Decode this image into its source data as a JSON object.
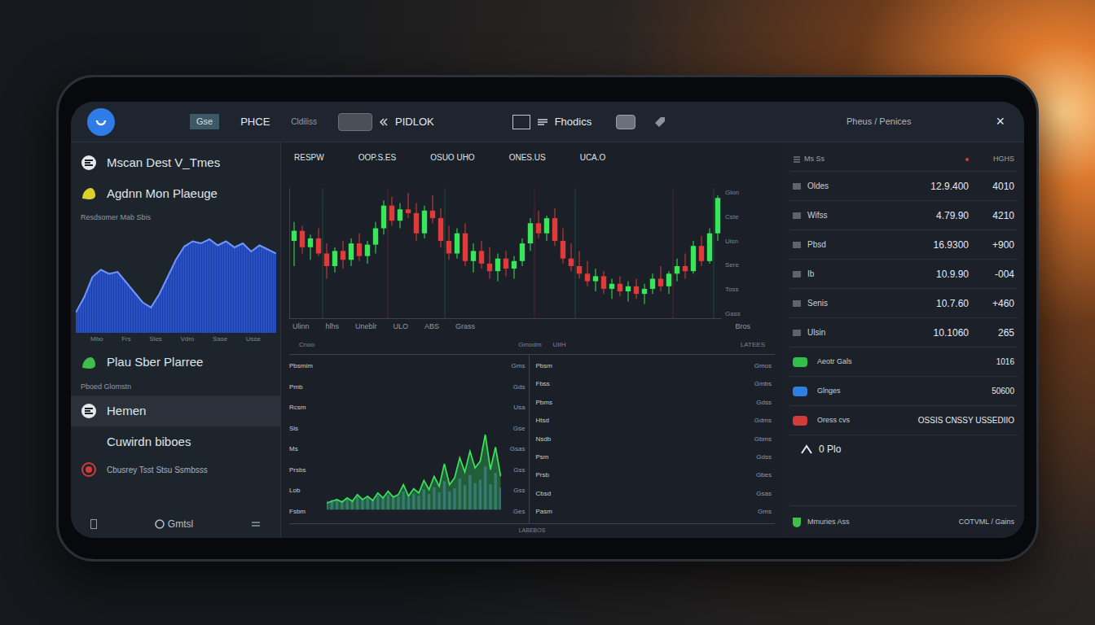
{
  "topbar": {
    "nav": [
      {
        "label": "Gse",
        "kind": "badge"
      },
      {
        "label": "PHCE",
        "kind": "text"
      },
      {
        "label": "Cldiliss",
        "kind": "muted"
      },
      {
        "label": "PIDLOK",
        "kind": "chip"
      },
      {
        "label": "Fhodics",
        "kind": "box"
      }
    ],
    "account": "Pheus / Penices",
    "close": "×"
  },
  "sidebar": {
    "top_items": [
      {
        "label": "Mscan Dest V_Tmes",
        "selected": false,
        "color": "#e5e7eb"
      },
      {
        "label": "Agdnn Mon Plaeuge",
        "selected": false,
        "color": "#d8d22a"
      }
    ],
    "wave": {
      "caption": "Resdsomer Mab Sbis",
      "values": [
        20,
        35,
        55,
        62,
        58,
        60,
        50,
        40,
        30,
        25,
        38,
        55,
        72,
        85,
        90,
        88,
        92,
        86,
        90,
        84,
        88,
        80,
        86,
        82,
        78
      ],
      "ticks": [
        "Mbo",
        "Frs",
        "Sles",
        "Vdro",
        "Sase",
        "Usse"
      ]
    },
    "first_group": [
      {
        "label": "Plau Sber Plarree",
        "selected": false,
        "kind": "large",
        "color": "#3fbf4a"
      }
    ],
    "section_caption": "Pboed Glomstn",
    "second_group": [
      {
        "label": "Hemen",
        "selected": true,
        "kind": "large",
        "color": "#e5e7eb"
      },
      {
        "label": "Cuwirdn biboes",
        "selected": false,
        "kind": "large",
        "color": "#e5e7eb"
      },
      {
        "label": "Cbusrey Tsst Stsu Ssmbsss",
        "selected": false,
        "kind": "small",
        "color": "#d33a3a"
      }
    ],
    "footer": "Gmtsl"
  },
  "market": {
    "columns": [
      "RESPW",
      "OOP.S.ES",
      "OSUO UHO",
      "ONES.US",
      "UCA.O"
    ],
    "candles": [
      [
        60,
        75,
        40,
        68
      ],
      [
        68,
        72,
        50,
        55
      ],
      [
        55,
        65,
        45,
        62
      ],
      [
        62,
        70,
        48,
        50
      ],
      [
        50,
        58,
        30,
        40
      ],
      [
        40,
        55,
        35,
        52
      ],
      [
        52,
        60,
        38,
        45
      ],
      [
        45,
        62,
        40,
        58
      ],
      [
        58,
        66,
        44,
        48
      ],
      [
        48,
        60,
        42,
        57
      ],
      [
        57,
        75,
        50,
        70
      ],
      [
        70,
        92,
        65,
        88
      ],
      [
        88,
        95,
        72,
        76
      ],
      [
        76,
        90,
        70,
        85
      ],
      [
        85,
        98,
        78,
        82
      ],
      [
        82,
        90,
        60,
        66
      ],
      [
        66,
        88,
        62,
        84
      ],
      [
        84,
        96,
        74,
        78
      ],
      [
        78,
        86,
        55,
        60
      ],
      [
        60,
        72,
        45,
        50
      ],
      [
        50,
        70,
        46,
        66
      ],
      [
        66,
        74,
        40,
        44
      ],
      [
        44,
        58,
        35,
        52
      ],
      [
        52,
        60,
        38,
        42
      ],
      [
        42,
        55,
        30,
        36
      ],
      [
        36,
        50,
        28,
        46
      ],
      [
        46,
        52,
        32,
        38
      ],
      [
        38,
        48,
        30,
        44
      ],
      [
        44,
        62,
        40,
        58
      ],
      [
        58,
        78,
        52,
        74
      ],
      [
        74,
        84,
        62,
        66
      ],
      [
        66,
        80,
        60,
        78
      ],
      [
        78,
        86,
        56,
        60
      ],
      [
        60,
        70,
        42,
        46
      ],
      [
        46,
        58,
        36,
        40
      ],
      [
        40,
        52,
        30,
        34
      ],
      [
        34,
        44,
        24,
        28
      ],
      [
        28,
        38,
        20,
        32
      ],
      [
        32,
        36,
        18,
        22
      ],
      [
        22,
        30,
        14,
        26
      ],
      [
        26,
        32,
        16,
        20
      ],
      [
        20,
        28,
        12,
        24
      ],
      [
        24,
        30,
        14,
        18
      ],
      [
        18,
        26,
        10,
        22
      ],
      [
        22,
        34,
        18,
        30
      ],
      [
        30,
        40,
        20,
        24
      ],
      [
        24,
        36,
        18,
        34
      ],
      [
        34,
        46,
        28,
        40
      ],
      [
        40,
        50,
        30,
        36
      ],
      [
        36,
        60,
        34,
        56
      ],
      [
        56,
        64,
        40,
        44
      ],
      [
        44,
        70,
        42,
        66
      ],
      [
        66,
        96,
        60,
        94
      ]
    ],
    "axis_right": [
      "Glon",
      "Cste",
      "Ulsn",
      "Sere",
      "Toss",
      "Gass"
    ],
    "axis_bottom": [
      "Ulinn",
      "hlhs",
      "Uneblr",
      "ULO",
      "ABS",
      "Grass"
    ],
    "axis_bottom_right": "Bros",
    "subheader": {
      "left": "Cnoo",
      "center": [
        "Gmodm",
        "UIIH"
      ],
      "right": "LATEES"
    },
    "panels": [
      {
        "left_labels": [
          "Pbsmim",
          "Pmb",
          "Rcsm",
          "Sis",
          "Ms",
          "Prsbs",
          "Lob",
          "Fsbm"
        ],
        "right_labels": [
          "Gms",
          "Gds",
          "Usa",
          "Gse",
          "Gsas",
          "Gss",
          "Gss",
          "Ges"
        ],
        "values": [
          8,
          10,
          12,
          9,
          14,
          10,
          18,
          12,
          16,
          11,
          20,
          14,
          22,
          15,
          18,
          30,
          16,
          25,
          20,
          35,
          24,
          40,
          28,
          55,
          30,
          38,
          62,
          45,
          70,
          50,
          58,
          90,
          48,
          75,
          40
        ]
      },
      {
        "left_labels": [
          "Pbsm",
          "Fbss",
          "Pbms",
          "Htsd",
          "Nsdb",
          "Psm",
          "Prsb",
          "Cbsd",
          "Pasm"
        ],
        "right_labels": [
          "Gmos",
          "Gmbs",
          "Gdss",
          "Gdms",
          "Gbms",
          "Gdss",
          "Gbes",
          "Gsas",
          "Gms"
        ],
        "values": []
      }
    ],
    "footer": "LABEBOS"
  },
  "watchlist": {
    "header": {
      "left": "Ms Ss",
      "right": "HGHS"
    },
    "rows": [
      {
        "name": "Oldes",
        "price": "12.9.400",
        "change": "4010"
      },
      {
        "name": "Wifss",
        "price": "4.79.90",
        "change": "4210"
      },
      {
        "name": "Pbsd",
        "price": "16.9300",
        "change": "+900"
      },
      {
        "name": "Ib",
        "price": "10.9.90",
        "change": "-004"
      },
      {
        "name": "Senis",
        "price": "10.7.60",
        "change": "+460"
      },
      {
        "name": "Ulsin",
        "price": "10.1060",
        "change": "265"
      }
    ],
    "extras": [
      {
        "label": "Aeotr Gals",
        "value": "1016",
        "color": "#2fbf4a"
      },
      {
        "label": "Glnges",
        "value": "50600",
        "color": "#2f7fe0"
      },
      {
        "label": "Oress cvs",
        "value": "OSSIS CNSSY USSEDIIO",
        "color": "#d33a3a"
      }
    ],
    "action_label": "0 Plo",
    "footer": {
      "left": "Mmuries Ass",
      "right": "COTVML / Gains"
    }
  }
}
